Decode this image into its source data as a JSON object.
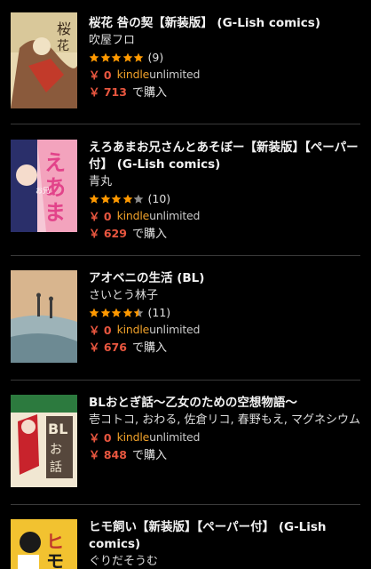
{
  "books": [
    {
      "title": "桜花 咎の契【新装版】 (G-Lish comics)",
      "author": "吹屋フロ",
      "rating": 5,
      "review_count": "(9)",
      "ku_price": "￥ 0",
      "ku_kindle": "kindle",
      "ku_unlimited": "unlimited",
      "buy_price": "￥ 713",
      "buy_label": "で購入",
      "cover_colors": [
        "#d9c89a",
        "#8a5a3c",
        "#c23a2a",
        "#f0e2c4"
      ]
    },
    {
      "title": "えろあまお兄さんとあそぼー【新装版】【ペーパー付】 (G-Lish comics)",
      "author": "青丸",
      "rating": 4,
      "review_count": "(10)",
      "ku_price": "￥ 0",
      "ku_kindle": "kindle",
      "ku_unlimited": "unlimited",
      "buy_price": "￥ 629",
      "buy_label": "で購入",
      "cover_colors": [
        "#f3a3bd",
        "#e2438a",
        "#2a2f6a",
        "#ffffff"
      ]
    },
    {
      "title": "アオベニの生活 (BL)",
      "author": "さいとう林子",
      "rating": 4.5,
      "review_count": "(11)",
      "ku_price": "￥ 0",
      "ku_kindle": "kindle",
      "ku_unlimited": "unlimited",
      "buy_price": "￥ 676",
      "buy_label": "で購入",
      "cover_colors": [
        "#d8b58e",
        "#9db3b8",
        "#6d8a93",
        "#e9dcc6"
      ]
    },
    {
      "title": "BLおとぎ話～乙女のための空想物語～",
      "author": "壱コトコ, おわる, 佐倉リコ, 春野もえ, マグネシウム",
      "ku_price": "￥ 0",
      "ku_kindle": "kindle",
      "ku_unlimited": "unlimited",
      "buy_price": "￥ 848",
      "buy_label": "で購入",
      "cover_colors": [
        "#f1e7d2",
        "#c8232c",
        "#2c7a3e",
        "#3b2a22"
      ]
    },
    {
      "title": "ヒモ飼い【新装版】【ペーパー付】 (G-Lish comics)",
      "author": "ぐりだそうむ",
      "cover_colors": [
        "#f2c230",
        "#1a1a1a",
        "#c0392b",
        "#ffffff"
      ]
    }
  ],
  "colors": {
    "background": "#000000",
    "price_red": "#e8563f",
    "star_orange": "#ff9900",
    "kindle_orange": "#f0a12a",
    "divider": "#3a3a3a"
  },
  "icons": {
    "star_full": "star-icon",
    "star_half": "star-half-icon",
    "star_empty": "star-empty-icon"
  }
}
